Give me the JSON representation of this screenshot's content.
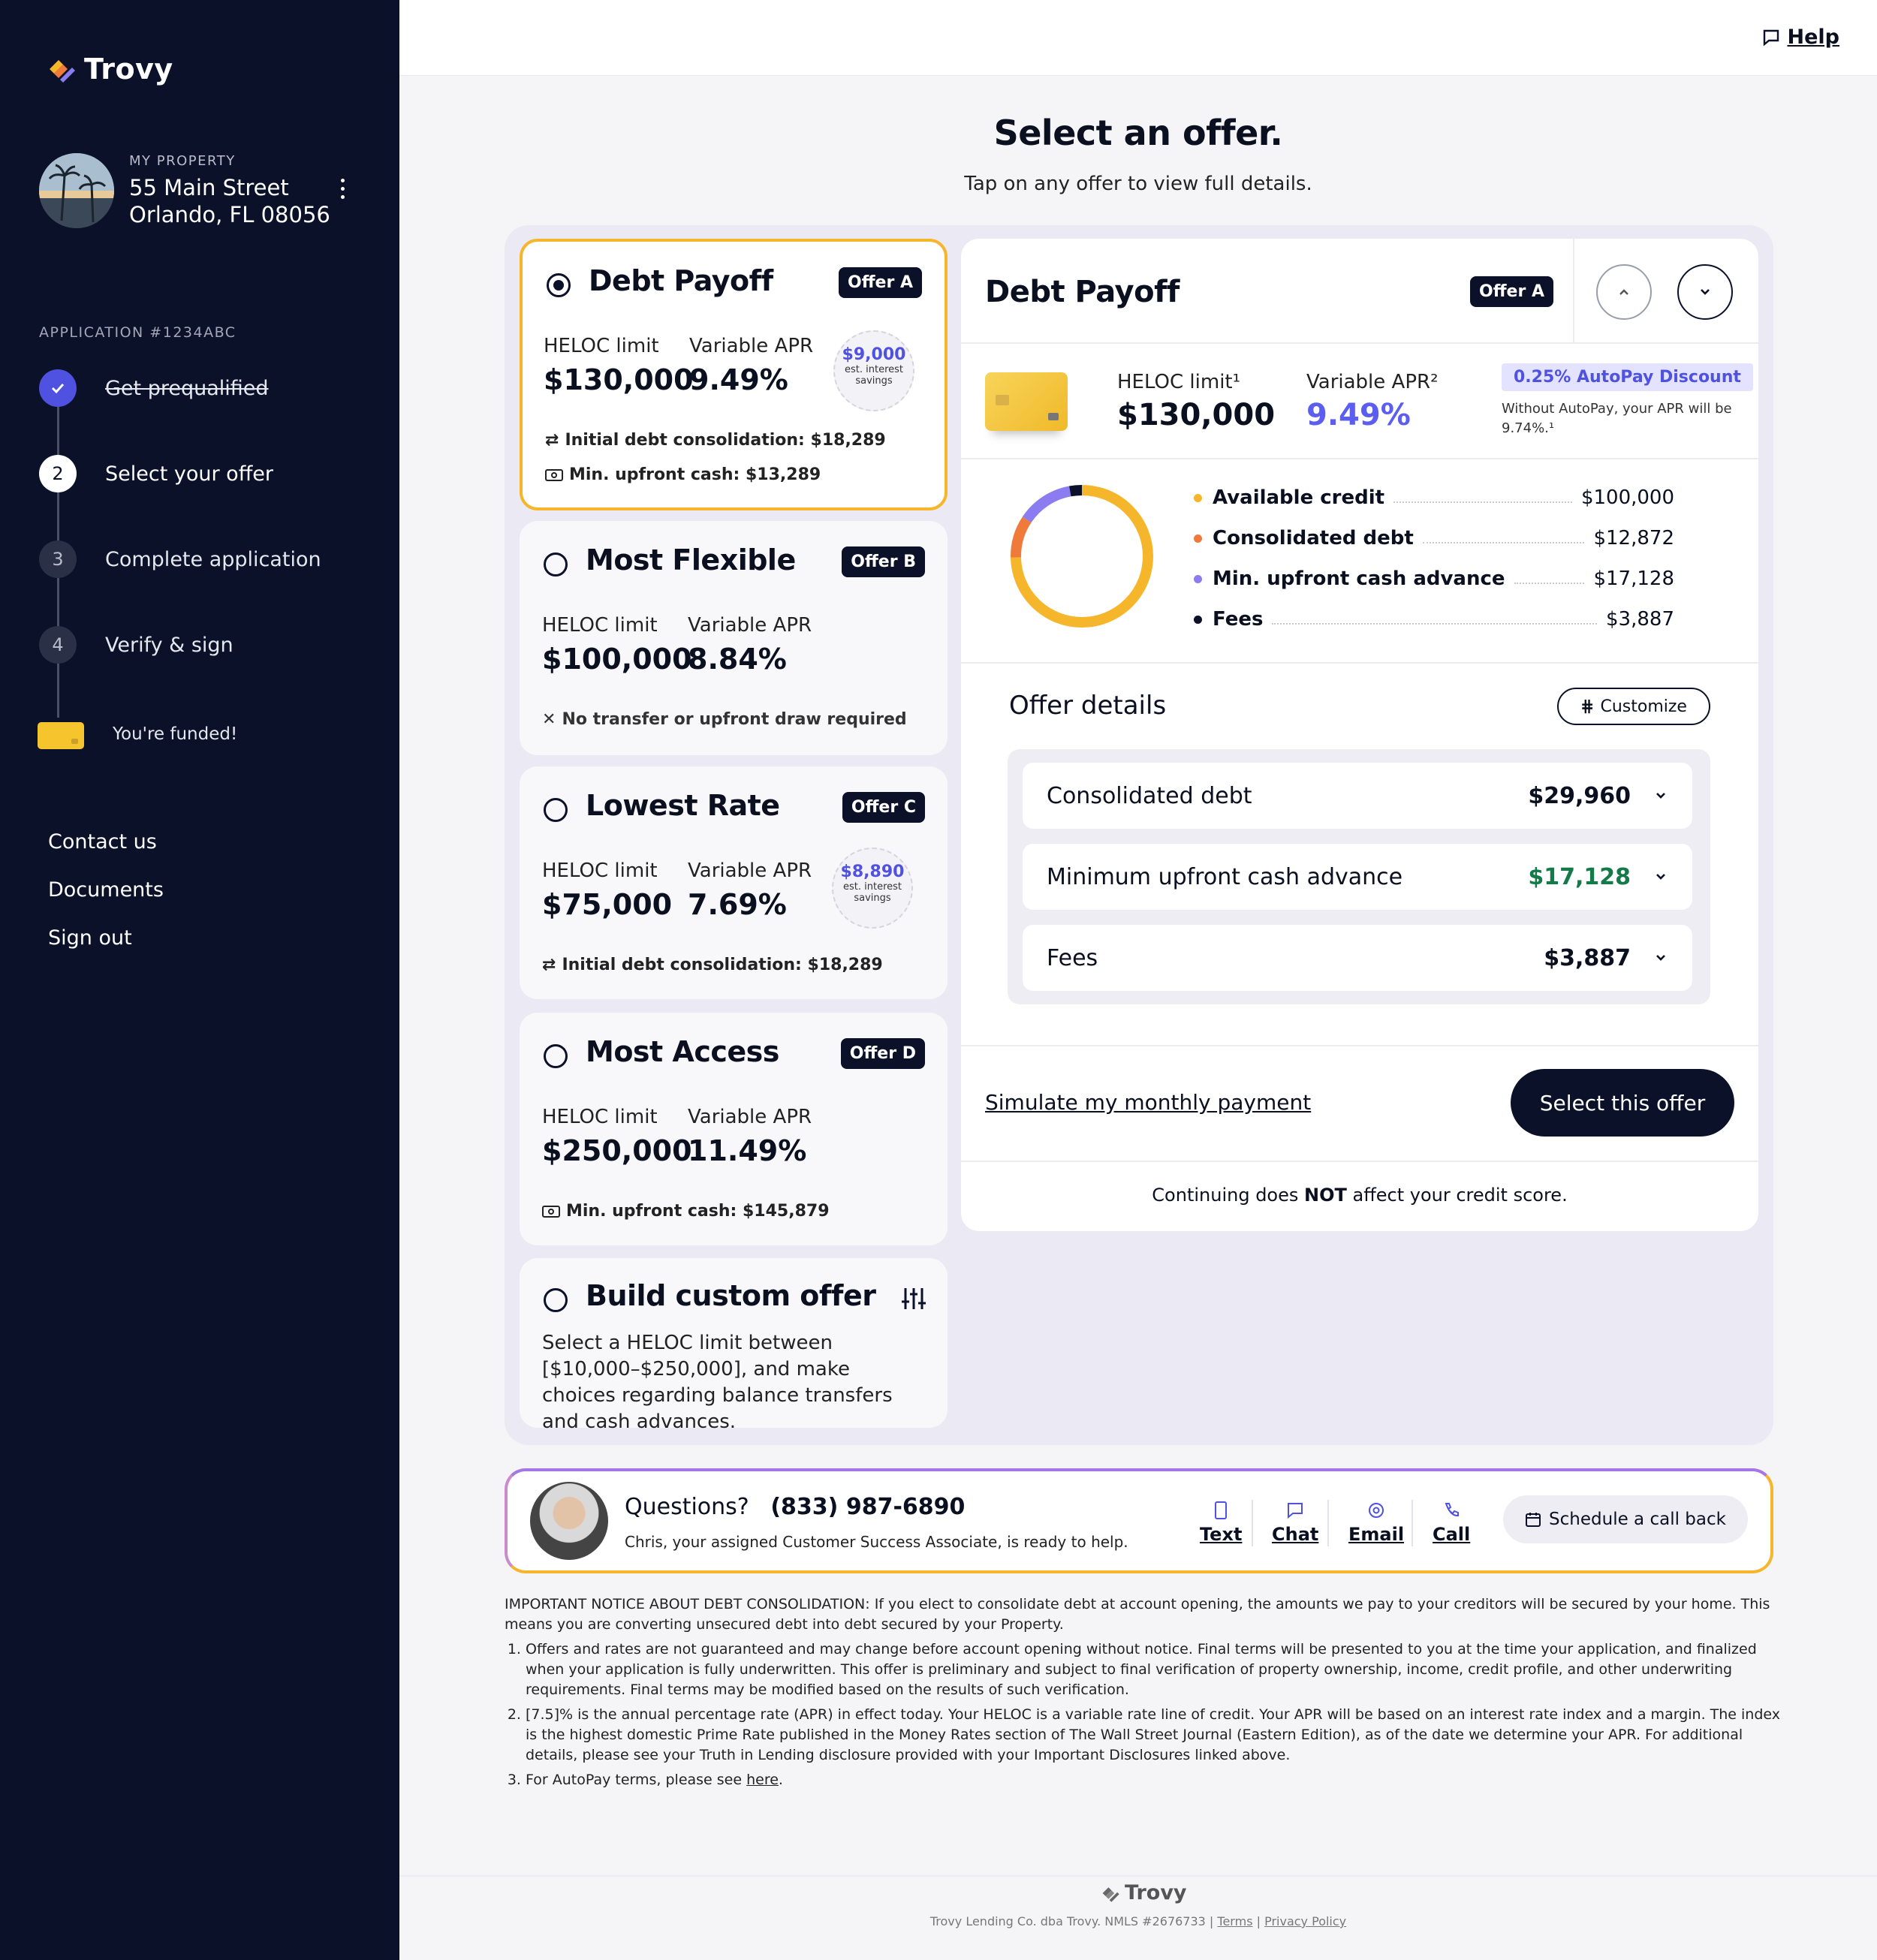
{
  "brand": {
    "name": "Trovy"
  },
  "property": {
    "label": "MY PROPERTY",
    "line1": "55 Main Street",
    "line2": "Orlando, FL 08056"
  },
  "application": {
    "label": "APPLICATION #1234ABC"
  },
  "steps": [
    {
      "num": "",
      "label": "Get prequalified",
      "state": "done"
    },
    {
      "num": "2",
      "label": "Select your offer",
      "state": "current"
    },
    {
      "num": "3",
      "label": "Complete application",
      "state": "todo"
    },
    {
      "num": "4",
      "label": "Verify & sign",
      "state": "todo"
    },
    {
      "num": "",
      "label": "You're funded!",
      "state": "final"
    }
  ],
  "side_links": [
    "Contact us",
    "Documents",
    "Sign out"
  ],
  "header": {
    "help": "Help"
  },
  "page": {
    "title": "Select an offer.",
    "subtitle": "Tap on any offer to view full details."
  },
  "offers": [
    {
      "title": "Debt Payoff",
      "badge": "Offer A",
      "limit_label": "HELOC limit",
      "limit": "$130,000",
      "apr_label": "Variable APR",
      "apr": "9.49%",
      "savings": "$9,000",
      "savings_label": "est. interest savings",
      "note1": "Initial debt consolidation: $18,289",
      "note2": "Min. upfront cash: $13,289"
    },
    {
      "title": "Most Flexible",
      "badge": "Offer B",
      "limit_label": "HELOC limit",
      "limit": "$100,000",
      "apr_label": "Variable APR",
      "apr": "8.84%",
      "note1": "No transfer or upfront draw required"
    },
    {
      "title": "Lowest Rate",
      "badge": "Offer C",
      "limit_label": "HELOC limit",
      "limit": "$75,000",
      "apr_label": "Variable APR",
      "apr": "7.69%",
      "savings": "$8,890",
      "savings_label": "est. interest savings",
      "note1": "Initial debt consolidation: $18,289"
    },
    {
      "title": "Most Access",
      "badge": "Offer D",
      "limit_label": "HELOC limit",
      "limit": "$250,000",
      "apr_label": "Variable APR",
      "apr": "11.49%",
      "note1": "Min. upfront cash: $145,879"
    },
    {
      "title": "Build custom offer",
      "desc": "Select a HELOC limit between [$10,000–$250,000], and make choices regarding balance transfers and cash advances."
    }
  ],
  "detail": {
    "title": "Debt Payoff",
    "badge": "Offer A",
    "limit_label": "HELOC limit¹",
    "limit": "$130,000",
    "apr_label": "Variable APR²",
    "apr": "9.49%",
    "autopay": "0.25% AutoPay Discount",
    "autopay_note": "Without AutoPay, your APR will be 9.74%.¹",
    "breakdown": [
      {
        "name": "Available credit",
        "value": "$100,000",
        "color": "#f6b62b",
        "amount": 100000
      },
      {
        "name": "Consolidated debt",
        "value": "$12,872",
        "color": "#f07a3a",
        "amount": 12872
      },
      {
        "name": "Min. upfront cash advance",
        "value": "$17,128",
        "color": "#8b7cf0",
        "amount": 17128
      },
      {
        "name": "Fees",
        "value": "$3,887",
        "color": "#0a1128",
        "amount": 3887
      }
    ],
    "details_title": "Offer details",
    "customize": "Customize",
    "items": [
      {
        "name": "Consolidated debt",
        "value": "$29,960",
        "color": "#0b1020"
      },
      {
        "name": "Minimum upfront cash advance",
        "value": "$17,128",
        "color": "#157a4a"
      },
      {
        "name": "Fees",
        "value": "$3,887",
        "color": "#0b1020"
      }
    ],
    "simulate": "Simulate my monthly payment",
    "select": "Select this offer",
    "credit_pre": "Continuing does ",
    "credit_bold": "NOT",
    "credit_post": " affect your credit score."
  },
  "contact": {
    "questions": "Questions?",
    "phone": "(833) 987-6890",
    "sub": "Chris, your assigned Customer Success Associate, is ready to help.",
    "actions": [
      "Text",
      "Chat",
      "Email",
      "Call"
    ],
    "schedule": "Schedule a call back"
  },
  "fine": {
    "notice": "IMPORTANT NOTICE ABOUT DEBT CONSOLIDATION: If you elect to consolidate debt at account opening, the amounts we pay to your creditors will be secured by your home. This means you are converting unsecured debt into debt secured by your Property.",
    "items": [
      "Offers and rates are not guaranteed and may change before account opening without notice. Final terms will be presented to you at the time your application, and finalized when your application is fully underwritten. This offer is preliminary and subject to final verification of property ownership, income, credit profile, and other underwriting requirements. Final terms may be modified based on the results of such verification.",
      "[7.5]% is the annual percentage rate (APR) in effect today. Your HELOC is a variable rate line of credit. Your APR will be based on an interest rate index and a margin. The index is the highest domestic Prime Rate published in the Money Rates section of The Wall Street Journal (Eastern Edition), as of the date we determine your APR. For additional details, please see your Truth in Lending disclosure provided with your Important Disclosures linked above."
    ],
    "item3_pre": "For AutoPay terms, please see ",
    "item3_link": "here",
    "item3_post": "."
  },
  "footer": {
    "brand": "Trovy",
    "legal": "Trovy Lending Co. dba Trovy. NMLS #2676733",
    "terms": "Terms",
    "privacy": "Privacy Policy"
  }
}
